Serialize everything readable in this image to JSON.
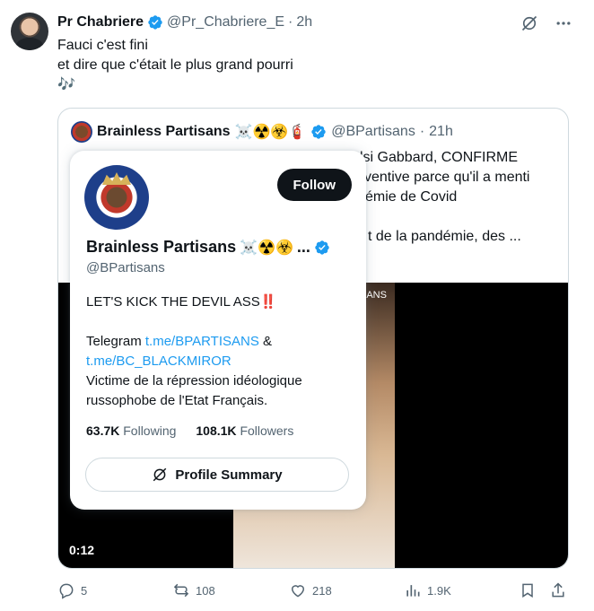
{
  "tweet": {
    "author_name": "Pr Chabriere",
    "handle": "@Pr_Chabriere_E",
    "separator": "·",
    "time": "2h",
    "lines": [
      "Fauci c'est fini",
      "et dire que c'était le plus grand pourri",
      "🎶"
    ]
  },
  "quote": {
    "author_name": "Brainless Partisans",
    "emojis": "☠️☢️☣️🧯",
    "handle": "@BPartisans",
    "separator": "·",
    "time": "21h",
    "visible_fragments": [
      "lsi Gabbard, CONFIRME",
      "ventive parce qu'il a menti",
      "émie de Covid",
      "",
      "t de la pandémie, des ..."
    ],
    "video_overlay_text": "SANS",
    "video_time": "0:12"
  },
  "hovercard": {
    "follow_label": "Follow",
    "name": "Brainless Partisans",
    "emojis": "☠️☢️☣️",
    "ellipsis": "...",
    "handle": "@BPartisans",
    "bio_line1": "LET'S KICK THE DEVIL ASS‼️",
    "bio_telegram": "Telegram ",
    "bio_link1": "t.me/BPARTISANS",
    "bio_amp": " &",
    "bio_link2": "t.me/BC_BLACKMIROR",
    "bio_line3": "Victime de la répression idéologique",
    "bio_line4": "russophobe de l'Etat Français.",
    "following_count": "63.7K",
    "following_label": "Following",
    "followers_count": "108.1K",
    "followers_label": "Followers",
    "profile_summary_label": "Profile Summary"
  },
  "actions": {
    "replies": "5",
    "reposts": "108",
    "likes": "218",
    "views": "1.9K"
  },
  "colors": {
    "verified": "#1d9bf0",
    "text_secondary": "#536471",
    "link": "#1d9bf0"
  }
}
